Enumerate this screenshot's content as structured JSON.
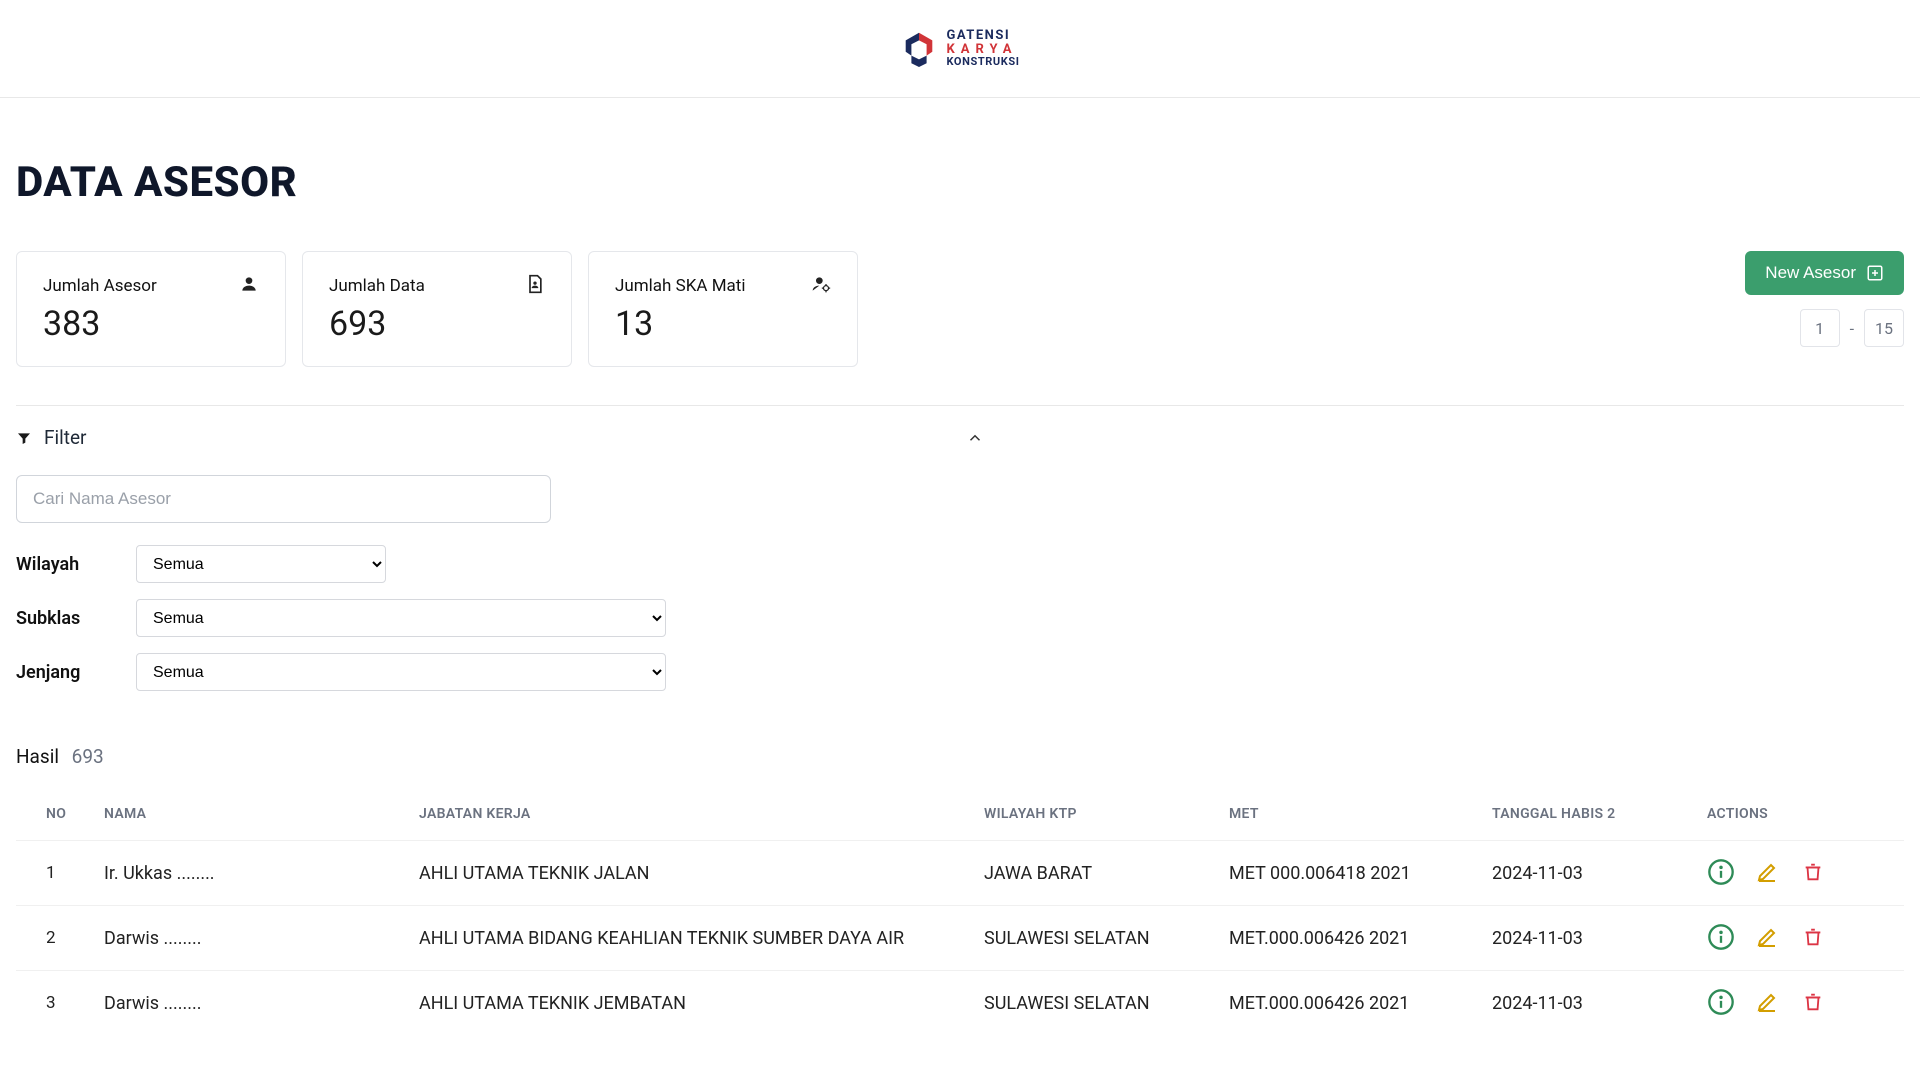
{
  "brand": {
    "line1": "GATENSI",
    "line2": "KARYA",
    "line3": "KONSTRUKSI"
  },
  "page": {
    "title": "DATA ASESOR"
  },
  "cards": [
    {
      "label": "Jumlah Asesor",
      "value": "383",
      "icon": "person"
    },
    {
      "label": "Jumlah Data",
      "value": "693",
      "icon": "doc"
    },
    {
      "label": "Jumlah SKA Mati",
      "value": "13",
      "icon": "person-gear"
    }
  ],
  "actions": {
    "new_button": "New Asesor"
  },
  "pager": {
    "from": "1",
    "sep": "-",
    "to": "15"
  },
  "filter": {
    "title": "Filter",
    "search_placeholder": "Cari Nama Asesor",
    "wilayah_label": "Wilayah",
    "subklas_label": "Subklas",
    "jenjang_label": "Jenjang",
    "option_all": "Semua"
  },
  "results": {
    "label": "Hasil",
    "count": "693"
  },
  "columns": {
    "no": "NO",
    "nama": "NAMA",
    "jabatan": "JABATAN KERJA",
    "wilayah": "WILAYAH KTP",
    "met": "MET",
    "tgl": "TANGGAL HABIS 2",
    "actions": "ACTIONS"
  },
  "rows": [
    {
      "no": "1",
      "nama": "Ir. Ukkas ........",
      "jabatan": "AHLI UTAMA TEKNIK JALAN",
      "wilayah": "JAWA BARAT",
      "met": "MET 000.006418 2021",
      "tgl": "2024-11-03"
    },
    {
      "no": "2",
      "nama": "Darwis ........",
      "jabatan": "AHLI UTAMA BIDANG KEAHLIAN TEKNIK SUMBER DAYA AIR",
      "wilayah": "SULAWESI SELATAN",
      "met": "MET.000.006426 2021",
      "tgl": "2024-11-03"
    },
    {
      "no": "3",
      "nama": "Darwis ........",
      "jabatan": "AHLI UTAMA TEKNIK JEMBATAN",
      "wilayah": "SULAWESI SELATAN",
      "met": "MET.000.006426 2021",
      "tgl": "2024-11-03"
    }
  ]
}
